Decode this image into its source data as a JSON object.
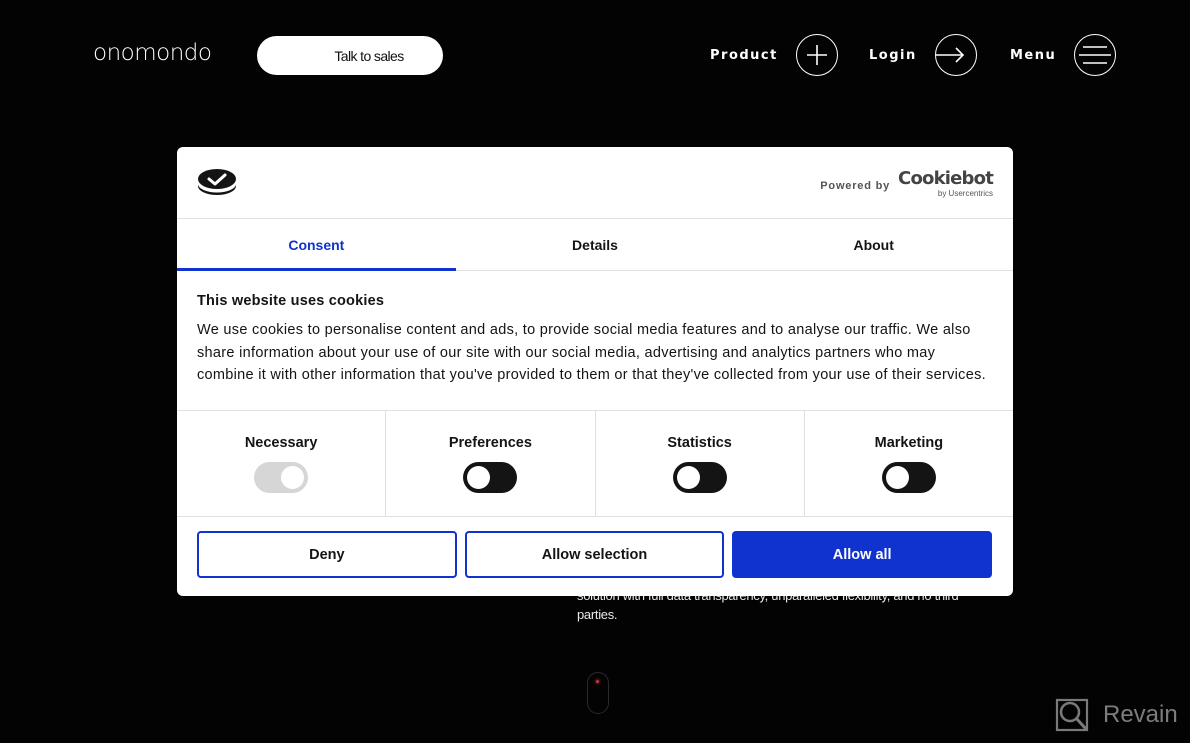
{
  "header": {
    "logo": "onomondo",
    "talk_to_sales": "Talk to sales",
    "nav": [
      {
        "label": "Product",
        "icon": "plus-icon"
      },
      {
        "label": "Login",
        "icon": "arrow-right-icon"
      },
      {
        "label": "Menu",
        "icon": "hamburger-icon"
      }
    ]
  },
  "background": {
    "hero_text_partial": "solution with full data transparency, unparalleled flexibility, and no third parties."
  },
  "dialog": {
    "logo_icon": "cookiebot-check-icon",
    "powered_by": "Powered by",
    "brand_name": "Cookiebot",
    "brand_sub": "by Usercentrics",
    "tabs": [
      {
        "label": "Consent",
        "active": true
      },
      {
        "label": "Details",
        "active": false
      },
      {
        "label": "About",
        "active": false
      }
    ],
    "title": "This website uses cookies",
    "description": "We use cookies to personalise content and ads, to provide social media features and to analyse our traffic. We also share information about your use of our site with our social media, advertising and analytics partners who may combine it with other information that you've provided to them or that they've collected from your use of their services.",
    "categories": [
      {
        "label": "Necessary",
        "checked": true,
        "disabled": true
      },
      {
        "label": "Preferences",
        "checked": false,
        "disabled": false
      },
      {
        "label": "Statistics",
        "checked": false,
        "disabled": false
      },
      {
        "label": "Marketing",
        "checked": false,
        "disabled": false
      }
    ],
    "buttons": {
      "deny": "Deny",
      "allow_selection": "Allow selection",
      "allow_all": "Allow all"
    },
    "accent_color": "#1032cf"
  },
  "watermark": {
    "label": "Revain"
  }
}
